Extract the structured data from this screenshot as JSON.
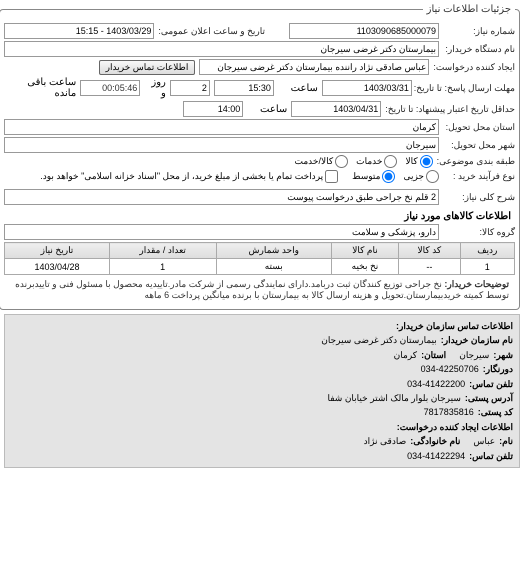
{
  "legend": "جزئیات اطلاعات نیاز",
  "fields": {
    "reqNo_label": "شماره نیاز:",
    "reqNo": "1103090685000079",
    "announceDate_label": "تاریخ و ساعت اعلان عمومی:",
    "announceDate": "1403/03/29 - 15:15",
    "buyerOrg_label": "نام دستگاه خریدار:",
    "buyerOrg": "بیمارستان دکتر غرضی سیرجان",
    "creator_label": "ایجاد کننده درخواست:",
    "creator": "عباس صادقی نژاد راننده بیمارستان دکتر غرضی سیرجان",
    "contactBtn": "اطلاعات تماس خریدار",
    "deadlineSend_label": "مهلت ارسال پاسخ: تا تاریخ:",
    "deadlineSend_date": "1403/03/31",
    "time_label": "ساعت",
    "deadlineSend_time": "15:30",
    "remainDays": "2",
    "day_label": "روز و",
    "remainTime": "00:05:46",
    "remain_label": "ساعت باقی مانده",
    "validity_label": "حداقل تاریخ اعتبار پیشنهاد: تا تاریخ:",
    "validity_date": "1403/04/31",
    "validity_time": "14:00",
    "province_label": "استان محل تحویل:",
    "province": "کرمان",
    "city_label": "شهر محل تحویل:",
    "city": "سیرجان",
    "budget_label": "طبقه بندی موضوعی:",
    "budget_opts": {
      "kala": "کالا",
      "khadamat": "خدمات",
      "both": "کالا/خدمت"
    },
    "process_label": "نوع فرآیند خرید :",
    "process_opts": {
      "low": "جزیی",
      "mid": "متوسط"
    },
    "process_note": "پرداخت تمام یا بخشی از مبلغ خرید، از محل \"اسناد خزانه اسلامی\" خواهد بود.",
    "desc_label": "شرح کلی نیاز:",
    "desc": "2 قلم نخ جراحی طبق درخواست پیوست",
    "goodsInfo_title": "اطلاعات کالاهای مورد نیاز",
    "goodsGroup_label": "گروه کالا:",
    "goodsGroup": "دارو، پزشکی و سلامت"
  },
  "table": {
    "headers": {
      "row": "ردیف",
      "code": "کد کالا",
      "name": "نام کالا",
      "unit": "واحد شمارش",
      "qty": "تعداد / مقدار",
      "reqDate": "تاریخ نیاز"
    },
    "rows": [
      {
        "row": "1",
        "code": "--",
        "name": "نخ بخیه",
        "unit": "بسته",
        "qty": "1",
        "reqDate": "1403/04/28"
      }
    ]
  },
  "notes": {
    "buyerNote_label": "توضیحات خریدار:",
    "buyerNote": "نخ جراحی توزیع کنندگان ثبت دربامد.دارای نمایندگی رسمی از شرکت مادر.تاییدیه محصول با مسئول فنی و تاییدبرنده توسط کمیته خریدبیمارستان.تحویل و هزینه ارسال کالا به بیمارستان با برنده میانگین پرداخت 6 ماهه"
  },
  "contact": {
    "title": "اطلاعات تماس سازمان خریدار:",
    "org_label": "نام سازمان خریدار:",
    "org": "بیمارستان دکتر غرضی سیرجان",
    "city_label": "شهر:",
    "city": "سیرجان",
    "province_label": "استان:",
    "province": "کرمان",
    "fax_label": "دورنگار:",
    "fax": "034-42250706",
    "phone_label": "تلفن تماس:",
    "phone": "034-41422200",
    "addr_label": "آدرس پستی:",
    "addr": "سیرجان بلوار مالک اشتر خیابان شفا",
    "postal_label": "کد پستی:",
    "postal": "7817835816",
    "creatorTitle": "اطلاعات ایجاد کننده درخواست:",
    "name_label": "نام:",
    "name": "عباس",
    "lastname_label": "نام خانوادگی:",
    "lastname": "صادقی نژاد",
    "cphone_label": "تلفن تماس:",
    "cphone": "034-41422294"
  }
}
